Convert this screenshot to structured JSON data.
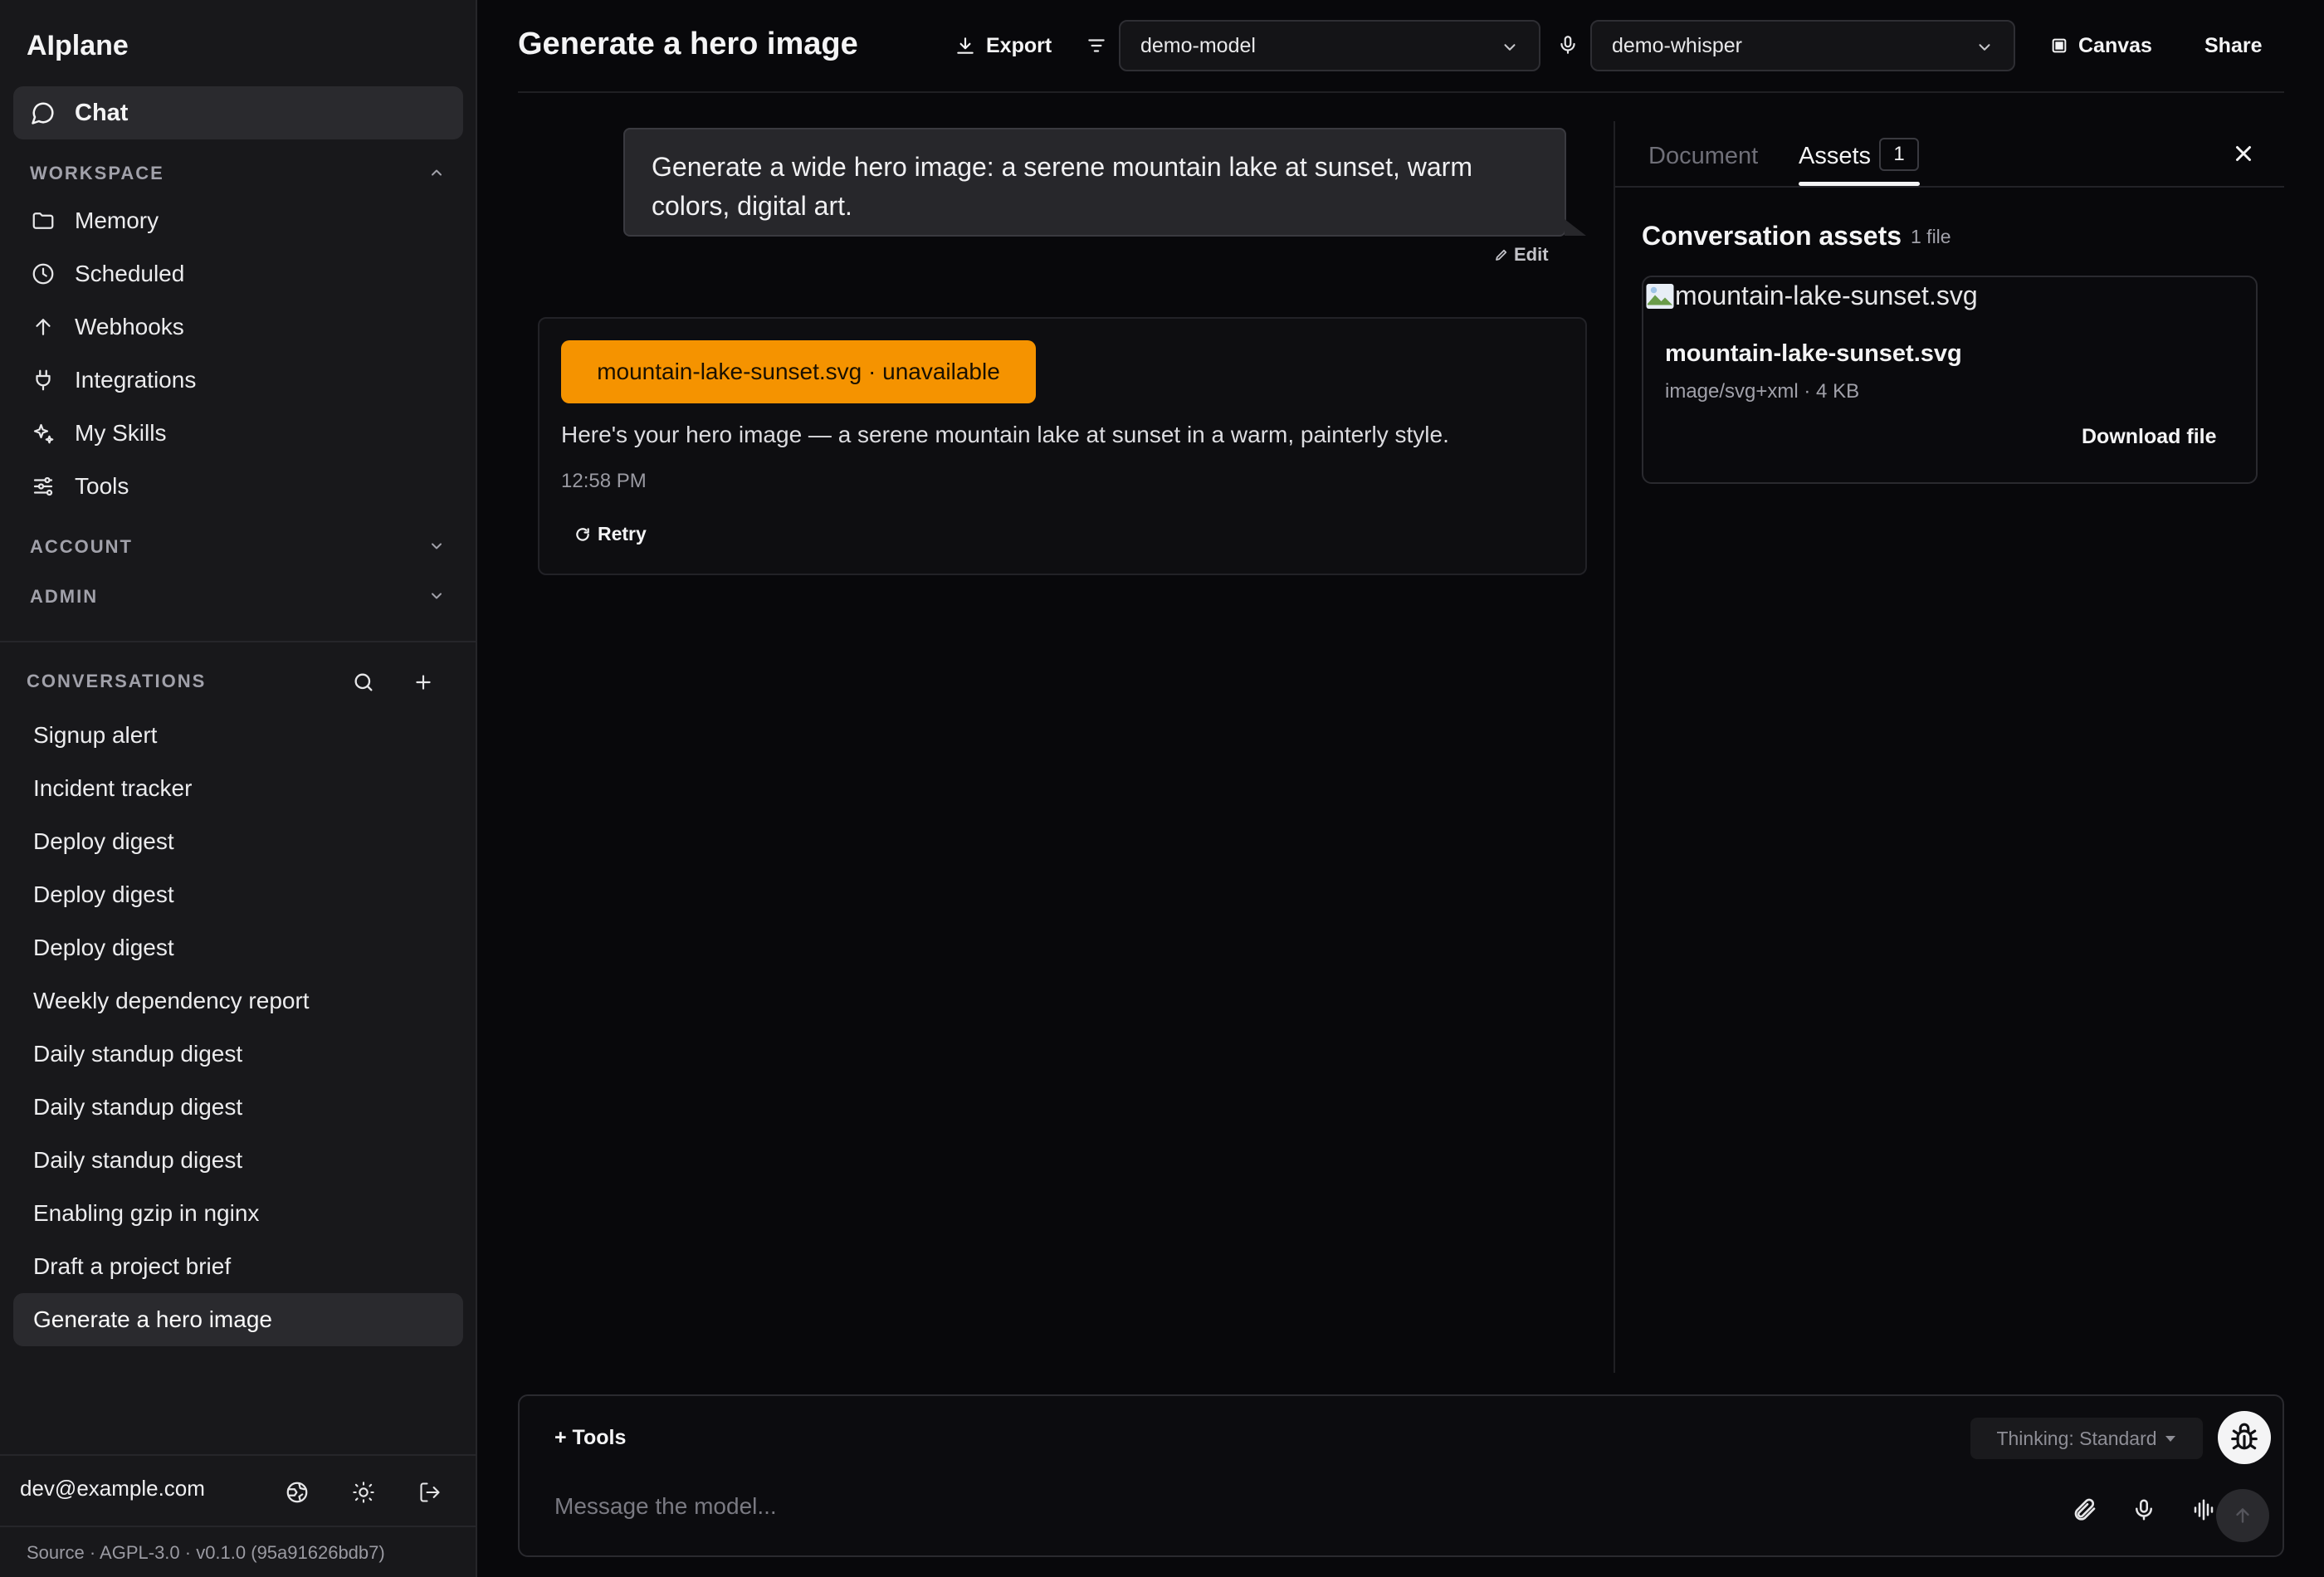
{
  "app": {
    "name": "AIplane"
  },
  "sidebar": {
    "chat_label": "Chat",
    "workspace_label": "WORKSPACE",
    "workspace_items": [
      {
        "label": "Memory",
        "icon": "folder-icon"
      },
      {
        "label": "Scheduled",
        "icon": "clock-icon"
      },
      {
        "label": "Webhooks",
        "icon": "arrow-up-icon"
      },
      {
        "label": "Integrations",
        "icon": "plug-icon"
      },
      {
        "label": "My Skills",
        "icon": "sparkles-icon"
      },
      {
        "label": "Tools",
        "icon": "sliders-icon"
      }
    ],
    "account_label": "ACCOUNT",
    "admin_label": "ADMIN",
    "conversations_label": "CONVERSATIONS",
    "conversations": [
      "Signup alert",
      "Incident tracker",
      "Deploy digest",
      "Deploy digest",
      "Deploy digest",
      "Weekly dependency report",
      "Daily standup digest",
      "Daily standup digest",
      "Daily standup digest",
      "Enabling gzip in nginx",
      "Draft a project brief",
      "Generate a hero image"
    ],
    "active_conversation": "Generate a hero image",
    "user_email": "dev@example.com",
    "footer_source": "Source · AGPL-3.0 · v0.1.0 (95a91626bdb7)"
  },
  "header": {
    "title": "Generate a hero image",
    "export_label": "Export",
    "model_select": "demo-model",
    "voice_select": "demo-whisper",
    "canvas_label": "Canvas",
    "share_label": "Share"
  },
  "chat": {
    "user_message": "Generate a wide hero image: a serene mountain lake at sunset, warm colors, digital art.",
    "edit_label": "Edit",
    "assistant": {
      "file_pill": "mountain-lake-sunset.svg · unavailable",
      "text": "Here's your hero image — a serene mountain lake at sunset in a warm, painterly style.",
      "time": "12:58 PM",
      "retry_label": "Retry"
    }
  },
  "panel": {
    "tab_document": "Document",
    "tab_assets": "Assets",
    "assets_badge": "1",
    "assets_title": "Conversation assets",
    "assets_count": "1 file",
    "asset": {
      "alt": "mountain-lake-sunset.svg",
      "name": "mountain-lake-sunset.svg",
      "meta": "image/svg+xml · 4 KB",
      "download_label": "Download file"
    }
  },
  "composer": {
    "tools_label": "+ Tools",
    "thinking_label": "Thinking: Standard",
    "placeholder": "Message the model..."
  },
  "colors": {
    "accent_orange": "#f59300",
    "background": "#08080b",
    "sidebar": "#18181b"
  }
}
